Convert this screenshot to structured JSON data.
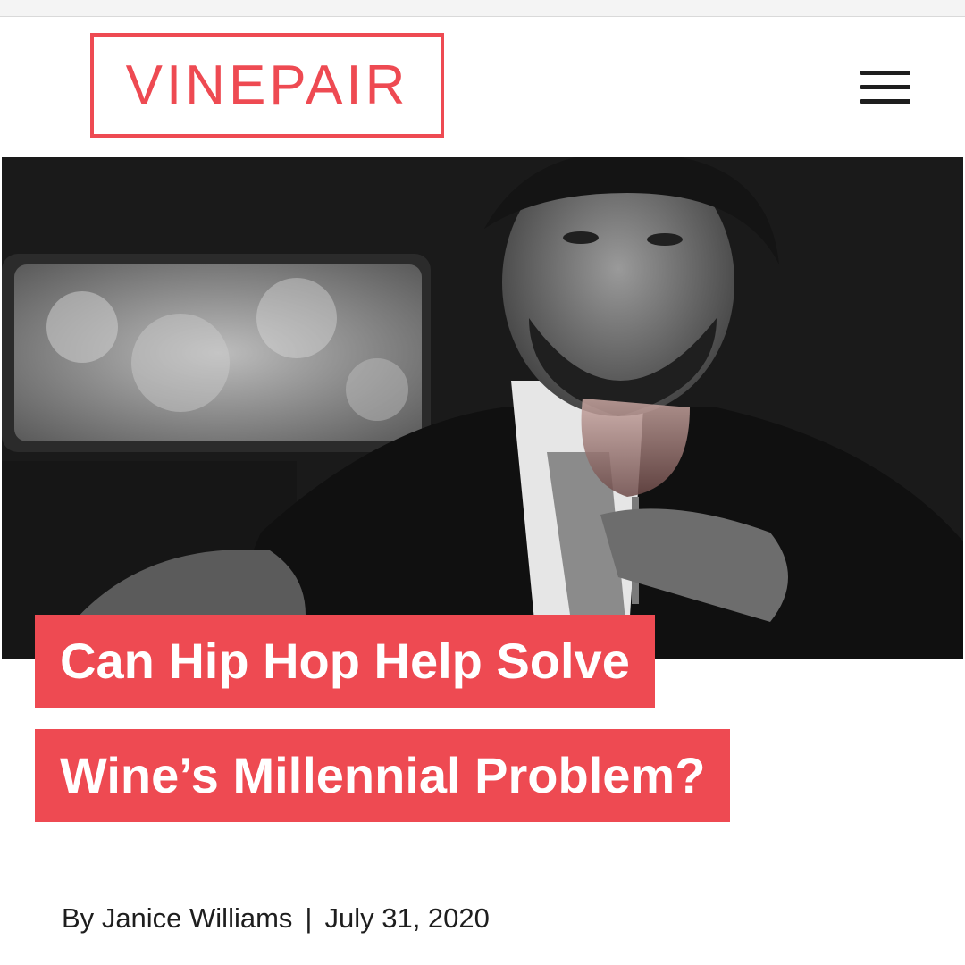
{
  "header": {
    "logo_text": "VINEPAIR",
    "menu_icon": "hamburger-menu-icon",
    "brand_color": "#ee4a52"
  },
  "hero": {
    "image_description_icon": "hero-photo"
  },
  "article": {
    "title_line_1": "Can Hip Hop Help Solve",
    "title_line_2": "Wine’s Millennial Problem?",
    "byline_prefix": "By",
    "author": "Janice Williams",
    "separator": "|",
    "date": "July 31, 2020"
  }
}
